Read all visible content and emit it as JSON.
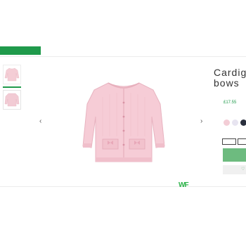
{
  "header": {
    "brand_bar_label": "",
    "nav_links": [
      "",
      "",
      "",
      ""
    ]
  },
  "product": {
    "breadcrumb": "",
    "title_line1": "Cardig",
    "title_line2": "bows",
    "subtitle": "",
    "price": "£17.55",
    "size_label": "",
    "sizes": [
      "",
      ""
    ],
    "colors": {
      "swatches": [
        "#f3cdd6",
        "#e7e4f0",
        "#2a2f3d"
      ],
      "accent": "#1f9a4b",
      "button": "#6dbb7f"
    }
  },
  "gallery": {
    "prev_arrow": "‹",
    "next_arrow": "›"
  },
  "footer": {
    "logo_mark": "WF",
    "logo_text_line1": "",
    "logo_text_line2": "",
    "small_text": ""
  },
  "icons": {
    "wishlist": "heart-icon"
  }
}
